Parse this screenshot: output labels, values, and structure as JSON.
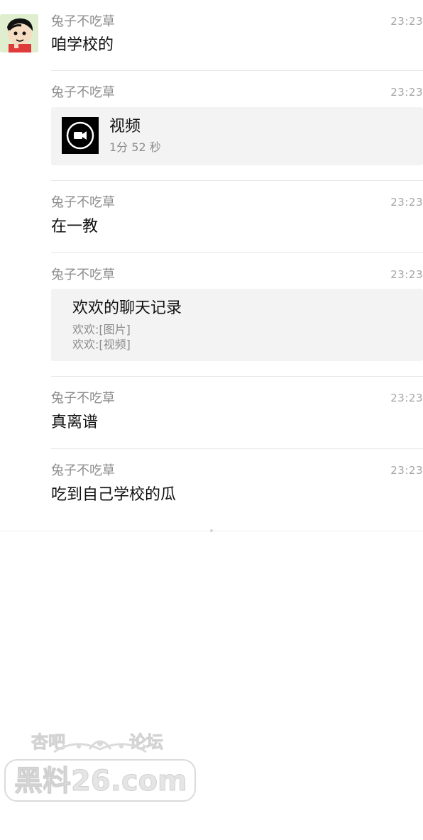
{
  "messages": [
    {
      "sender": "兔子不吃草",
      "time": "23:23",
      "text": "咱学校的"
    },
    {
      "sender": "兔子不吃草",
      "time": "23:23",
      "video": {
        "title": "视频",
        "duration": "1分 52 秒",
        "icon": "video-camera-icon"
      }
    },
    {
      "sender": "兔子不吃草",
      "time": "23:23",
      "text": "在一教"
    },
    {
      "sender": "兔子不吃草",
      "time": "23:23",
      "chat_record": {
        "title": "欢欢的聊天记录",
        "lines": [
          "欢欢:[图片]",
          "欢欢:[视频]"
        ]
      }
    },
    {
      "sender": "兔子不吃草",
      "time": "23:23",
      "text": "真离谱"
    },
    {
      "sender": "兔子不吃草",
      "time": "23:23",
      "text": "吃到自己学校的瓜"
    }
  ],
  "avatar": {
    "icon": "cartoon-boy-avatar"
  },
  "watermark": {
    "top_left": "杏吧",
    "top_right": "论坛",
    "main": "黑料26.com"
  },
  "colors": {
    "background": "#ffffff",
    "card": "#f3f3f3",
    "meta_text": "#8c8c8c",
    "divider": "#e6e6e6"
  }
}
